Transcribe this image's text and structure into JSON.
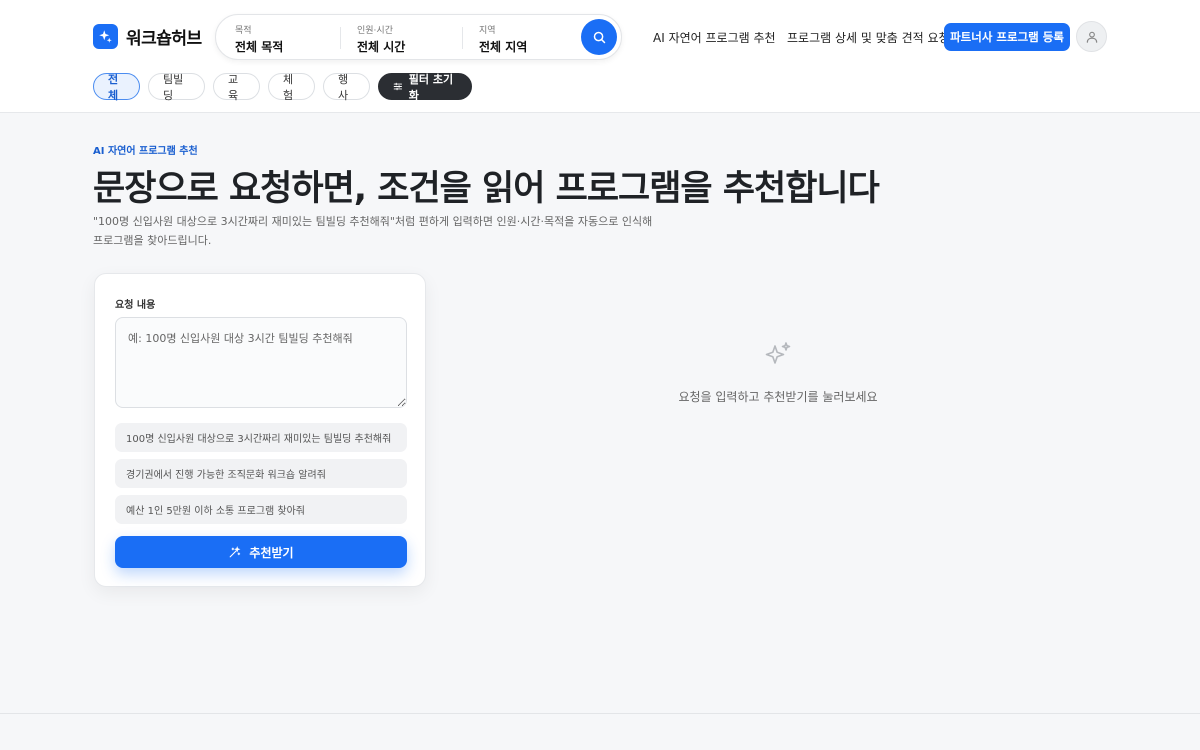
{
  "brand": {
    "name": "워크숍허브"
  },
  "search": {
    "purpose_label": "목적",
    "purpose_value": "전체 목적",
    "people_label": "인원·시간",
    "people_value": "전체 시간",
    "region_label": "지역",
    "region_value": "전체 지역"
  },
  "nav": {
    "ai_recommend": "AI 자연어 프로그램 추천",
    "quote_request": "프로그램 상세 및 맞춤 견적 요청",
    "partner_register": "파트너사 프로그램 등록"
  },
  "filters": {
    "chips": [
      "전체",
      "팀빌딩",
      "교육",
      "체험",
      "행사"
    ],
    "active": "전체",
    "reset": "필터 초기화"
  },
  "hero": {
    "eyebrow": "AI 자연어 프로그램 추천",
    "title": "문장으로 요청하면, 조건을 읽어 프로그램을 추천합니다",
    "description": "\"100명 신입사원 대상으로 3시간짜리 재미있는 팀빌딩 추천해줘\"처럼 편하게 입력하면 인원·시간·목적을 자동으로 인식해 프로그램을 찾아드립니다."
  },
  "request_card": {
    "label": "요청 내용",
    "placeholder": "예: 100명 신입사원 대상 3시간 팀빌딩 추천해줘",
    "examples": [
      "100명 신입사원 대상으로 3시간짜리 재미있는 팀빌딩 추천해줘",
      "경기권에서 진행 가능한 조직문화 워크숍 알려줘",
      "예산 1인 5만원 이하 소통 프로그램 찾아줘"
    ],
    "submit": "추천받기"
  },
  "result_panel": {
    "empty_message": "요청을 입력하고 추천받기를 눌러보세요",
    "icon": "sparkles-icon"
  },
  "colors": {
    "accent": "#1a6ef5",
    "dark_chip": "#2b2e33",
    "background": "#f6f7f9"
  }
}
